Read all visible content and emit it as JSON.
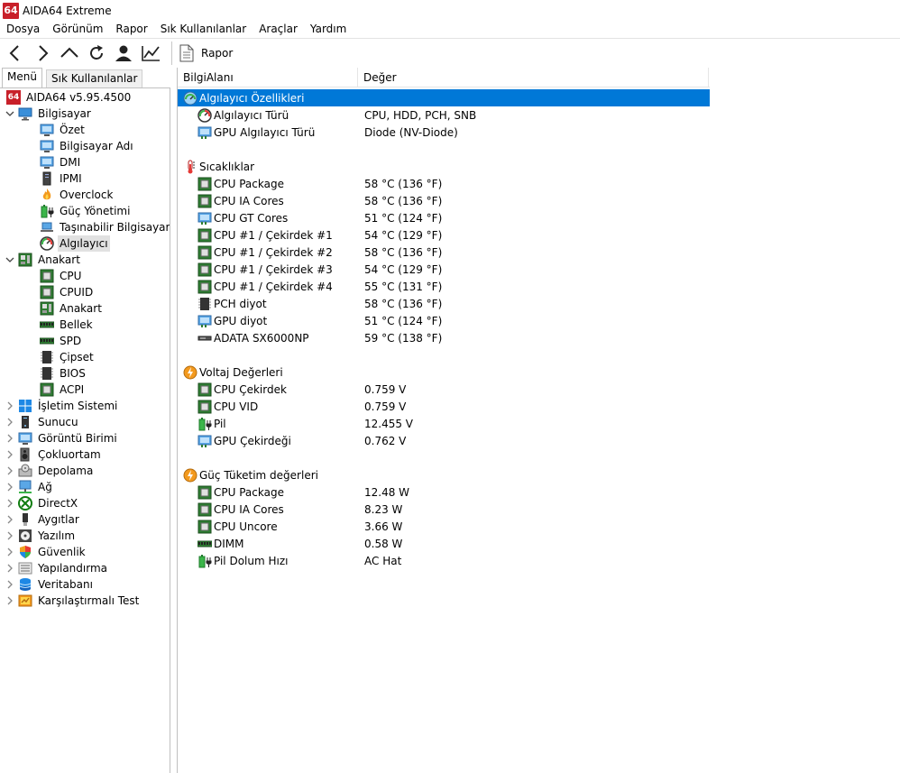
{
  "window": {
    "title": "AIDA64 Extreme",
    "logo_text": "64"
  },
  "menubar": [
    "Dosya",
    "Görünüm",
    "Rapor",
    "Sık Kullanılanlar",
    "Araçlar",
    "Yardım"
  ],
  "toolbar": {
    "report_label": "Rapor"
  },
  "tabs": {
    "menu": "Menü",
    "favorites": "Sık Kullanılanlar"
  },
  "tree": [
    {
      "label": "AIDA64 v5.95.4500",
      "icon": "aida64-logo-icon",
      "level": 0,
      "expander": "none"
    },
    {
      "label": "Bilgisayar",
      "icon": "computer-icon",
      "level": 0,
      "expander": "expanded"
    },
    {
      "label": "Özet",
      "icon": "monitor-icon",
      "level": 1
    },
    {
      "label": "Bilgisayar Adı",
      "icon": "monitor-icon",
      "level": 1
    },
    {
      "label": "DMI",
      "icon": "monitor-icon",
      "level": 1
    },
    {
      "label": "IPMI",
      "icon": "server-icon",
      "level": 1
    },
    {
      "label": "Overclock",
      "icon": "flame-icon",
      "level": 1
    },
    {
      "label": "Güç Yönetimi",
      "icon": "battery-plug-icon",
      "level": 1
    },
    {
      "label": "Taşınabilir Bilgisayar",
      "icon": "laptop-icon",
      "level": 1
    },
    {
      "label": "Algılayıcı",
      "icon": "sensor-gauge-icon",
      "level": 1,
      "selected": true
    },
    {
      "label": "Anakart",
      "icon": "motherboard-icon",
      "level": 0,
      "expander": "expanded"
    },
    {
      "label": "CPU",
      "icon": "chip-icon",
      "level": 1
    },
    {
      "label": "CPUID",
      "icon": "chip-icon",
      "level": 1
    },
    {
      "label": "Anakart",
      "icon": "motherboard-icon",
      "level": 1
    },
    {
      "label": "Bellek",
      "icon": "ram-icon",
      "level": 1
    },
    {
      "label": "SPD",
      "icon": "ram-icon",
      "level": 1
    },
    {
      "label": "Çipset",
      "icon": "chipset-icon",
      "level": 1
    },
    {
      "label": "BIOS",
      "icon": "chipset-icon",
      "level": 1
    },
    {
      "label": "ACPI",
      "icon": "chip-icon",
      "level": 1
    },
    {
      "label": "İşletim Sistemi",
      "icon": "windows-icon",
      "level": 0,
      "expander": "collapsed"
    },
    {
      "label": "Sunucu",
      "icon": "server-tower-icon",
      "level": 0,
      "expander": "collapsed"
    },
    {
      "label": "Görüntü Birimi",
      "icon": "monitor-icon",
      "level": 0,
      "expander": "collapsed"
    },
    {
      "label": "Çokluortam",
      "icon": "speaker-icon",
      "level": 0,
      "expander": "collapsed"
    },
    {
      "label": "Depolama",
      "icon": "disk-icon",
      "level": 0,
      "expander": "collapsed"
    },
    {
      "label": "Ağ",
      "icon": "network-icon",
      "level": 0,
      "expander": "collapsed"
    },
    {
      "label": "DirectX",
      "icon": "xbox-icon",
      "level": 0,
      "expander": "collapsed"
    },
    {
      "label": "Aygıtlar",
      "icon": "usb-device-icon",
      "level": 0,
      "expander": "collapsed"
    },
    {
      "label": "Yazılım",
      "icon": "software-disc-icon",
      "level": 0,
      "expander": "collapsed"
    },
    {
      "label": "Güvenlik",
      "icon": "shield-icon",
      "level": 0,
      "expander": "collapsed"
    },
    {
      "label": "Yapılandırma",
      "icon": "config-icon",
      "level": 0,
      "expander": "collapsed"
    },
    {
      "label": "Veritabanı",
      "icon": "database-icon",
      "level": 0,
      "expander": "collapsed"
    },
    {
      "label": "Karşılaştırmalı Test",
      "icon": "benchmark-icon",
      "level": 0,
      "expander": "collapsed"
    }
  ],
  "columns": {
    "field": "BilgiAlanı",
    "value": "Değer"
  },
  "rows": [
    {
      "type": "group",
      "field": "Algılayıcı Özellikleri",
      "icon": "sensor-globe-icon",
      "selected": true
    },
    {
      "type": "item",
      "field": "Algılayıcı Türü",
      "value": "CPU, HDD, PCH, SNB",
      "icon": "sensor-gauge-icon"
    },
    {
      "type": "item",
      "field": "GPU Algılayıcı Türü",
      "value": "Diode  (NV-Diode)",
      "icon": "gpu-icon"
    },
    {
      "type": "spacer"
    },
    {
      "type": "group",
      "field": "Sıcaklıklar",
      "icon": "thermometer-icon"
    },
    {
      "type": "item",
      "field": "CPU Package",
      "value": "58 °C  (136 °F)",
      "icon": "chip-icon"
    },
    {
      "type": "item",
      "field": "CPU IA Cores",
      "value": "58 °C  (136 °F)",
      "icon": "chip-icon"
    },
    {
      "type": "item",
      "field": "CPU GT Cores",
      "value": "51 °C  (124 °F)",
      "icon": "gpu-icon"
    },
    {
      "type": "item",
      "field": "CPU #1 / Çekirdek #1",
      "value": "54 °C  (129 °F)",
      "icon": "chip-icon"
    },
    {
      "type": "item",
      "field": "CPU #1 / Çekirdek #2",
      "value": "58 °C  (136 °F)",
      "icon": "chip-icon"
    },
    {
      "type": "item",
      "field": "CPU #1 / Çekirdek #3",
      "value": "54 °C  (129 °F)",
      "icon": "chip-icon"
    },
    {
      "type": "item",
      "field": "CPU #1 / Çekirdek #4",
      "value": "55 °C  (131 °F)",
      "icon": "chip-icon"
    },
    {
      "type": "item",
      "field": "PCH diyot",
      "value": "58 °C  (136 °F)",
      "icon": "chipset-icon"
    },
    {
      "type": "item",
      "field": "GPU diyot",
      "value": "51 °C  (124 °F)",
      "icon": "gpu-icon"
    },
    {
      "type": "item",
      "field": "ADATA SX6000NP",
      "value": "59 °C  (138 °F)",
      "icon": "ssd-icon"
    },
    {
      "type": "spacer"
    },
    {
      "type": "group",
      "field": "Voltaj Değerleri",
      "icon": "voltage-icon"
    },
    {
      "type": "item",
      "field": "CPU Çekirdek",
      "value": "0.759 V",
      "icon": "chip-icon"
    },
    {
      "type": "item",
      "field": "CPU VID",
      "value": "0.759 V",
      "icon": "chip-icon"
    },
    {
      "type": "item",
      "field": "Pil",
      "value": "12.455 V",
      "icon": "battery-plug-icon"
    },
    {
      "type": "item",
      "field": "GPU Çekirdeği",
      "value": "0.762 V",
      "icon": "gpu-icon"
    },
    {
      "type": "spacer"
    },
    {
      "type": "group",
      "field": "Güç Tüketim değerleri",
      "icon": "voltage-icon"
    },
    {
      "type": "item",
      "field": "CPU Package",
      "value": "12.48 W",
      "icon": "chip-icon"
    },
    {
      "type": "item",
      "field": "CPU IA Cores",
      "value": "8.23 W",
      "icon": "chip-icon"
    },
    {
      "type": "item",
      "field": "CPU Uncore",
      "value": "3.66 W",
      "icon": "chip-icon"
    },
    {
      "type": "item",
      "field": "DIMM",
      "value": "0.58 W",
      "icon": "ram-icon"
    },
    {
      "type": "item",
      "field": "Pil Dolum Hızı",
      "value": "AC Hat",
      "icon": "battery-plug-icon"
    }
  ]
}
